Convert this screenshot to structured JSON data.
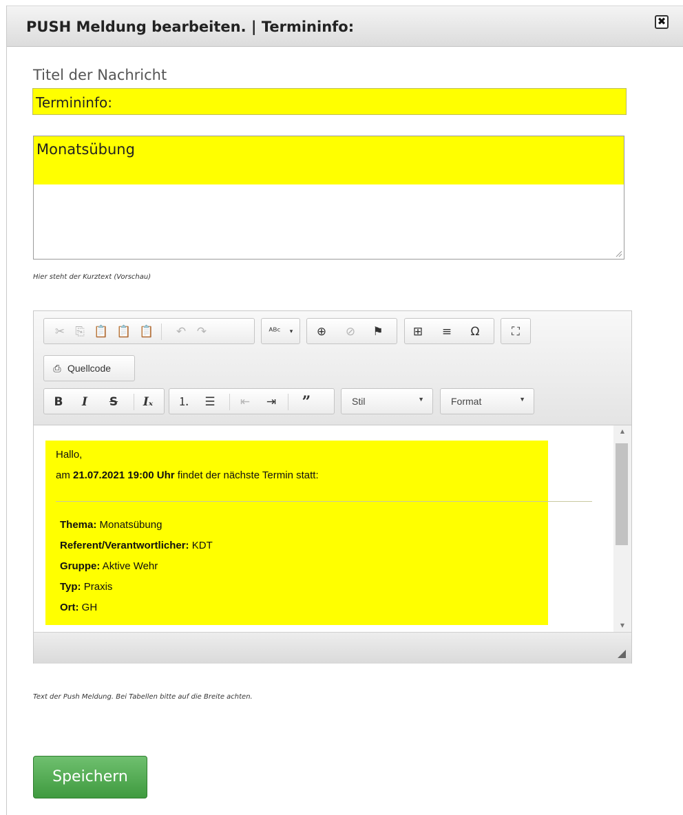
{
  "dialog": {
    "title": "PUSH Meldung bearbeiten. | Termininfo:",
    "close_icon": "✖"
  },
  "form": {
    "title_label": "Titel der Nachricht",
    "title_value": "Termininfo:",
    "short_text_value": "Monatsübung",
    "short_text_hint": "Hier steht der Kurztext (Vorschau)",
    "editor_hint": "Text der Push Meldung. Bei Tabellen bitte auf die Breite achten.",
    "save_label": "Speichern"
  },
  "toolbar": {
    "source_label": "Quellcode",
    "style_label": "Stil",
    "format_label": "Format",
    "icons": [
      "cut-icon",
      "copy-icon",
      "paste-icon",
      "paste-text-icon",
      "paste-word-icon",
      "undo-icon",
      "redo-icon",
      "spellcheck-icon",
      "link-icon",
      "unlink-icon",
      "anchor-icon",
      "table-icon",
      "horizontal-rule-icon",
      "special-char-icon",
      "maximize-icon",
      "source-icon",
      "bold-icon",
      "italic-icon",
      "strike-icon",
      "remove-format-icon",
      "numbered-list-icon",
      "bullet-list-icon",
      "outdent-icon",
      "indent-icon",
      "blockquote-icon"
    ]
  },
  "content": {
    "greeting": "Hallo,",
    "line_pre": "am ",
    "datetime": "21.07.2021 19:00 Uhr",
    "line_post": " findet der nächste Termin statt:",
    "fields": [
      {
        "label": "Thema:",
        "value": " Monatsübung"
      },
      {
        "label": "Referent/Verantwortlicher:",
        "value": " KDT"
      },
      {
        "label": "Gruppe:",
        "value": " Aktive Wehr"
      },
      {
        "label": "Typ:",
        "value": " Praxis"
      },
      {
        "label": "Ort:",
        "value": " GH"
      }
    ]
  },
  "colors": {
    "highlight": "#ffff00",
    "save_button": "#4caf50"
  }
}
